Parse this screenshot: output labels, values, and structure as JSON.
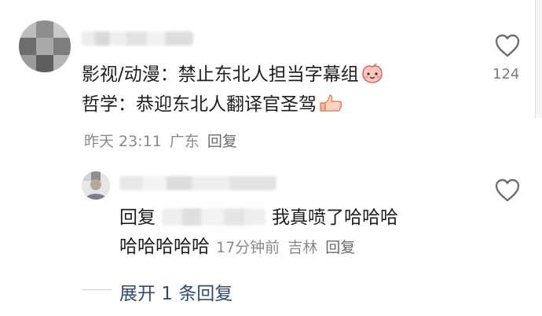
{
  "comment": {
    "line1": "影视/动漫：禁止东北人担当字幕组",
    "line2": "哲学：恭迎东北人翻译官圣驾",
    "emoji1": "peach-face-emoji",
    "emoji2": "thumbs-up-emoji",
    "time": "昨天 23:11",
    "location": "广东",
    "reply_label": "回复",
    "like_count": "124"
  },
  "reply": {
    "prefix": "回复",
    "text_part1": "我真喷了哈哈哈",
    "text_part2": "哈哈哈哈哈",
    "time": "17分钟前",
    "location": "吉林",
    "reply_label": "回复"
  },
  "expand": {
    "label": "展开 1 条回复"
  },
  "colors": {
    "text": "#1e1e1e",
    "meta": "#8a8a8a",
    "link": "#324a72",
    "heart": "#6f6f6f"
  }
}
